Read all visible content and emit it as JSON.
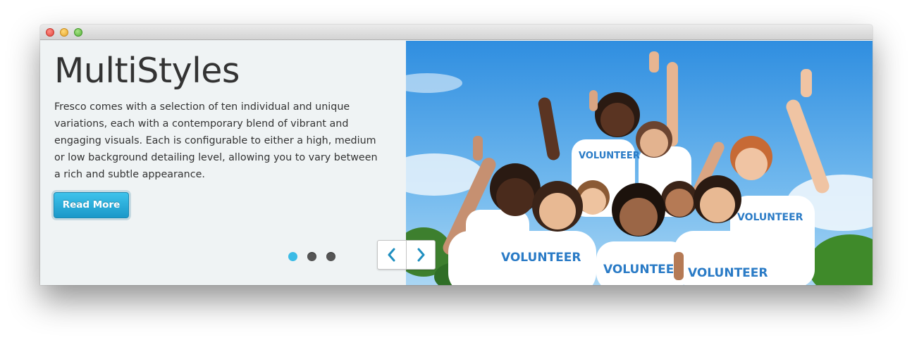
{
  "slide": {
    "title": "MultiStyles",
    "description": "Fresco comes with a selection of ten individual and unique variations, each with a contemporary blend of vibrant and engaging visuals. Each is configurable to either a high, medium or low background detailing level, allowing you to vary between a rich and subtle appearance.",
    "button_label": "Read More"
  },
  "pagination": {
    "total": 3,
    "active_index": 0
  },
  "navigation": {
    "prev_icon": "chevron-left-icon",
    "next_icon": "chevron-right-icon"
  },
  "image": {
    "shirt_text": "VOLUNTEER"
  },
  "colors": {
    "accent": "#2aaee0",
    "text": "#333333",
    "panel_bg": "#eff3f4",
    "sky": "#4d9fe3"
  }
}
